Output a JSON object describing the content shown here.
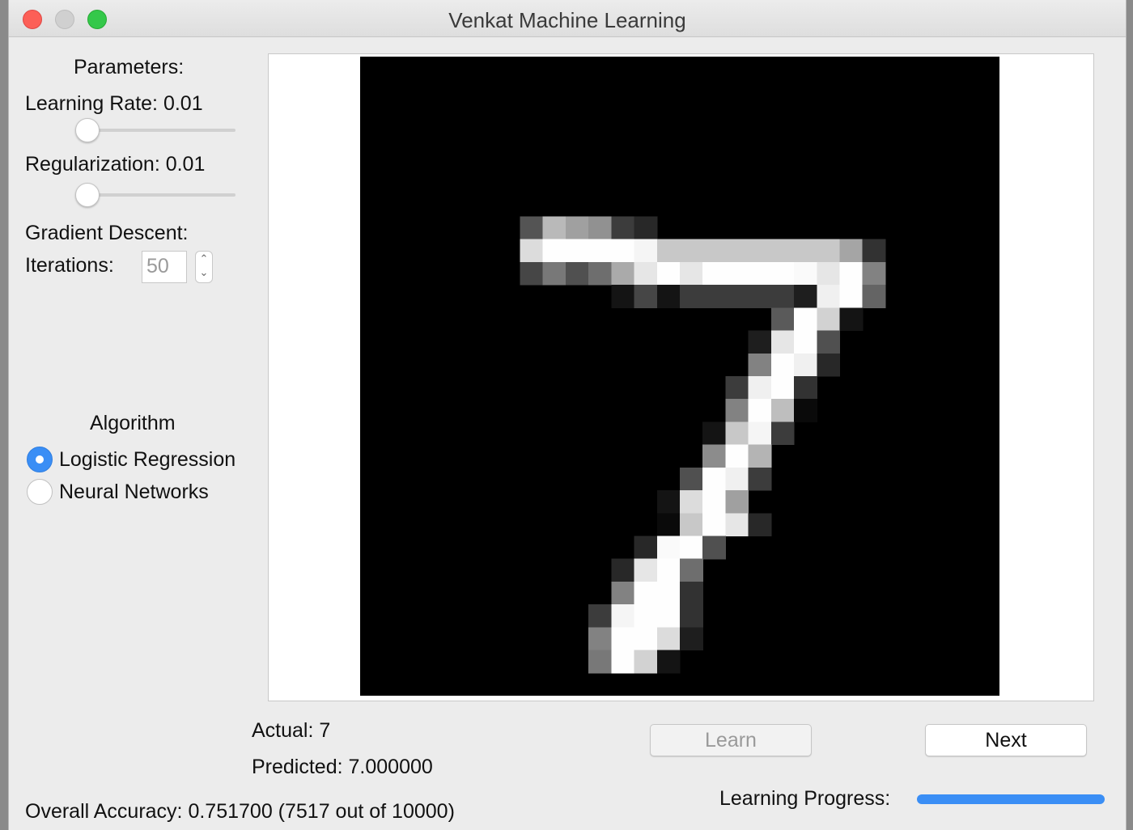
{
  "window": {
    "title": "Venkat Machine Learning"
  },
  "parameters": {
    "heading": "Parameters:",
    "learning_rate_label": "Learning Rate: 0.01",
    "learning_rate_level": 0.0,
    "regularization_label": "Regularization: 0.01",
    "regularization_level": 0.0,
    "gradient_descent_label": "Gradient Descent:",
    "iterations_label": "Iterations:",
    "iterations_value": "50"
  },
  "algorithm": {
    "heading": "Algorithm",
    "options": [
      {
        "label": "Logistic Regression",
        "selected": true
      },
      {
        "label": "Neural Networks",
        "selected": false
      }
    ]
  },
  "results": {
    "actual": "Actual: 7",
    "predicted": "Predicted: 7.000000",
    "overall_accuracy": "Overall Accuracy: 0.751700 (7517 out of 10000)"
  },
  "buttons": {
    "learn": "Learn",
    "next": "Next"
  },
  "progress": {
    "label": "Learning Progress:",
    "value": 1.0
  },
  "colors": {
    "accent": "#3a8ef5",
    "image_background": "#000000"
  },
  "digit_image": {
    "grid_size": 28,
    "pixels": [
      [
        7,
        7,
        84
      ],
      [
        8,
        7,
        185
      ],
      [
        9,
        7,
        160
      ],
      [
        10,
        7,
        145
      ],
      [
        11,
        7,
        60
      ],
      [
        12,
        7,
        40
      ],
      [
        7,
        8,
        220
      ],
      [
        8,
        8,
        254
      ],
      [
        9,
        8,
        254
      ],
      [
        10,
        8,
        254
      ],
      [
        11,
        8,
        254
      ],
      [
        12,
        8,
        245
      ],
      [
        13,
        8,
        200
      ],
      [
        14,
        8,
        200
      ],
      [
        15,
        8,
        200
      ],
      [
        16,
        8,
        200
      ],
      [
        17,
        8,
        200
      ],
      [
        18,
        8,
        200
      ],
      [
        19,
        8,
        200
      ],
      [
        20,
        8,
        200
      ],
      [
        21,
        8,
        165
      ],
      [
        22,
        8,
        50
      ],
      [
        7,
        9,
        70
      ],
      [
        8,
        9,
        120
      ],
      [
        9,
        9,
        80
      ],
      [
        10,
        9,
        110
      ],
      [
        11,
        9,
        170
      ],
      [
        12,
        9,
        230
      ],
      [
        13,
        9,
        254
      ],
      [
        14,
        9,
        230
      ],
      [
        15,
        9,
        254
      ],
      [
        16,
        9,
        254
      ],
      [
        17,
        9,
        254
      ],
      [
        18,
        9,
        254
      ],
      [
        19,
        9,
        250
      ],
      [
        20,
        9,
        230
      ],
      [
        21,
        9,
        254
      ],
      [
        22,
        9,
        130
      ],
      [
        11,
        10,
        20
      ],
      [
        12,
        10,
        70
      ],
      [
        13,
        10,
        20
      ],
      [
        14,
        10,
        60
      ],
      [
        15,
        10,
        60
      ],
      [
        16,
        10,
        60
      ],
      [
        17,
        10,
        60
      ],
      [
        18,
        10,
        60
      ],
      [
        19,
        10,
        30
      ],
      [
        20,
        10,
        240
      ],
      [
        21,
        10,
        254
      ],
      [
        22,
        10,
        100
      ],
      [
        18,
        11,
        90
      ],
      [
        19,
        11,
        254
      ],
      [
        20,
        11,
        210
      ],
      [
        21,
        11,
        20
      ],
      [
        17,
        12,
        30
      ],
      [
        18,
        12,
        230
      ],
      [
        19,
        12,
        254
      ],
      [
        20,
        12,
        80
      ],
      [
        17,
        13,
        130
      ],
      [
        18,
        13,
        254
      ],
      [
        19,
        13,
        240
      ],
      [
        20,
        13,
        40
      ],
      [
        16,
        14,
        60
      ],
      [
        17,
        14,
        240
      ],
      [
        18,
        14,
        254
      ],
      [
        19,
        14,
        50
      ],
      [
        16,
        15,
        130
      ],
      [
        17,
        15,
        254
      ],
      [
        18,
        15,
        190
      ],
      [
        19,
        15,
        10
      ],
      [
        15,
        16,
        20
      ],
      [
        16,
        16,
        200
      ],
      [
        17,
        16,
        245
      ],
      [
        18,
        16,
        60
      ],
      [
        15,
        17,
        140
      ],
      [
        16,
        17,
        254
      ],
      [
        17,
        17,
        180
      ],
      [
        14,
        18,
        80
      ],
      [
        15,
        18,
        254
      ],
      [
        16,
        18,
        240
      ],
      [
        17,
        18,
        60
      ],
      [
        13,
        19,
        20
      ],
      [
        14,
        19,
        220
      ],
      [
        15,
        19,
        254
      ],
      [
        16,
        19,
        160
      ],
      [
        13,
        20,
        10
      ],
      [
        14,
        20,
        200
      ],
      [
        15,
        20,
        254
      ],
      [
        16,
        20,
        230
      ],
      [
        17,
        20,
        40
      ],
      [
        12,
        21,
        40
      ],
      [
        13,
        21,
        250
      ],
      [
        14,
        21,
        254
      ],
      [
        15,
        21,
        80
      ],
      [
        11,
        22,
        40
      ],
      [
        12,
        22,
        230
      ],
      [
        13,
        22,
        254
      ],
      [
        14,
        22,
        110
      ],
      [
        11,
        23,
        130
      ],
      [
        12,
        23,
        254
      ],
      [
        13,
        23,
        254
      ],
      [
        14,
        23,
        50
      ],
      [
        10,
        24,
        60
      ],
      [
        11,
        24,
        245
      ],
      [
        12,
        24,
        254
      ],
      [
        13,
        24,
        254
      ],
      [
        14,
        24,
        50
      ],
      [
        10,
        25,
        130
      ],
      [
        11,
        25,
        254
      ],
      [
        12,
        25,
        254
      ],
      [
        13,
        25,
        220
      ],
      [
        14,
        25,
        30
      ],
      [
        10,
        26,
        120
      ],
      [
        11,
        26,
        254
      ],
      [
        12,
        26,
        210
      ],
      [
        13,
        26,
        20
      ]
    ]
  }
}
